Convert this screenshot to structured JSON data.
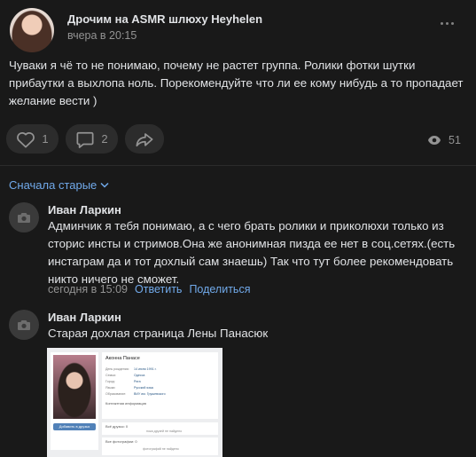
{
  "post": {
    "author": "Дрочим на ASMR шлюху Heyhelen",
    "time": "вчера в 20:15",
    "text": "Чуваки я чё то не понимаю, почему не растет группа. Ролики фотки шутки прибаутки а выхлопа ноль. Порекомендуйте что ли ее кому нибудь а то пропадает желание вести )",
    "likes": "1",
    "comments": "2",
    "views": "51"
  },
  "sort_label": "Сначала старые",
  "comments": [
    {
      "name": "Иван Ларкин",
      "text": "Админчик я тебя понимаю, а с чего брать ролики и приколюхи только из сторис инсты и стримов.Она же анонимная пизда ее нет в соц.сетях.(есть инстаграм да и тот дохлый сам знаешь) Так что тут более рекомендовать никто ничего не сможет.",
      "time": "сегодня в 15:09",
      "reply": "Ответить",
      "share": "Поделиться"
    },
    {
      "name": "Иван Ларкин",
      "text": "Старая дохлая страница Лены Панасюк"
    }
  ],
  "attachment": {
    "profile_name": "Аконна Панасe",
    "button": "Добавить в друзья",
    "rows": [
      {
        "label": "День рождения:",
        "value": "14 июня 1991 г."
      },
      {
        "label": "Семья:",
        "value": "Одесса"
      },
      {
        "label": "Город:",
        "value": "Рига"
      },
      {
        "label": "Языки:",
        "value": "Русский язык"
      },
      {
        "label": "Образование:",
        "value": "ВИУ им. Грушевского"
      }
    ],
    "more_info": "Контактная информация",
    "friends_label": "Всё друзья: 0",
    "friends_empty": "пока друзей не найдено",
    "photos_label": "Все фотографии: 0",
    "photos_empty": "фотографий не найдено"
  },
  "colors": {
    "background": "#191919",
    "link": "#71aaeb",
    "muted": "#939393",
    "text": "#e1e3e6",
    "button_bg": "#2c2c2c"
  }
}
